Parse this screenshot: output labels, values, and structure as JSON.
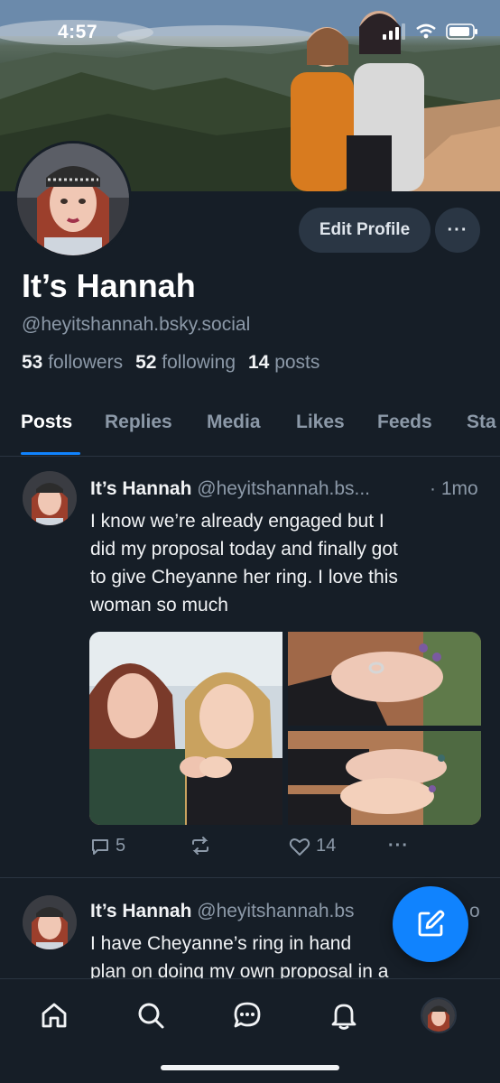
{
  "status_bar": {
    "time": "4:57"
  },
  "profile": {
    "display_name": "It’s Hannah",
    "handle": "@heyitshannah.bsky.social",
    "followers_count": "53",
    "followers_label": "followers",
    "following_count": "52",
    "following_label": "following",
    "posts_count": "14",
    "posts_label": "posts",
    "edit_label": "Edit Profile",
    "more_label": "···"
  },
  "tabs": [
    {
      "label": "Posts",
      "active": true
    },
    {
      "label": "Replies"
    },
    {
      "label": "Media"
    },
    {
      "label": "Likes"
    },
    {
      "label": "Feeds"
    },
    {
      "label": "Sta"
    }
  ],
  "posts": [
    {
      "author": "It’s Hannah",
      "handle": "@heyitshannah.bs...",
      "time": "· 1mo",
      "text_lines": [
        "I know we’re already engaged but I",
        "did my proposal today and finally got",
        "to give Cheyanne her ring. I love this",
        "woman so much"
      ],
      "reply_count": "5",
      "repost_count": "",
      "like_count": "14",
      "more_label": "···"
    },
    {
      "author": "It’s Hannah",
      "handle": "@heyitshannah.bs",
      "time": "o",
      "text_lines": [
        "I have Cheyanne’s ring in hand",
        "plan on doing my own proposal in a"
      ]
    }
  ],
  "bottom_nav": [
    "home-icon",
    "search-icon",
    "chat-icon",
    "bell-icon",
    "profile-avatar"
  ],
  "colors": {
    "background": "#161e27",
    "accent": "#1083fe",
    "muted": "#8c99a8",
    "button": "#2a3644"
  }
}
